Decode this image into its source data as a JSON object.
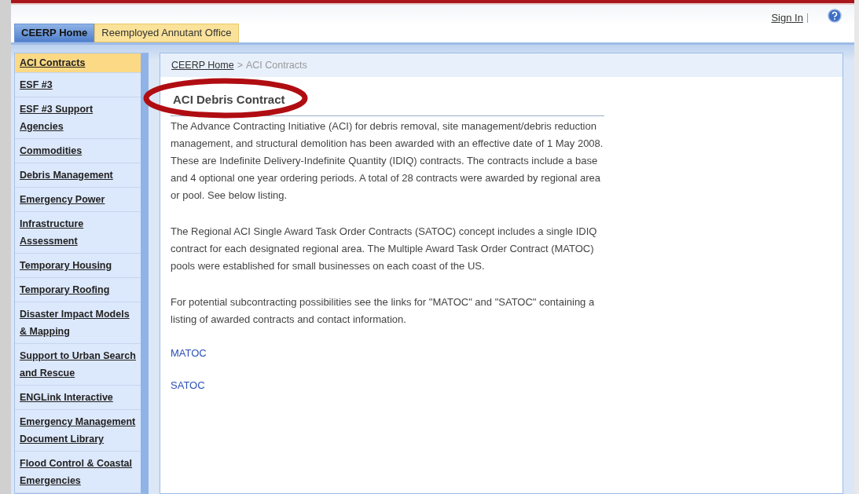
{
  "header": {
    "sign_in": "Sign In",
    "separator": "|"
  },
  "tabs": [
    {
      "label": "CEERP Home",
      "selected": true
    },
    {
      "label": "Reemployed Annutant Office",
      "selected": false
    }
  ],
  "sidebar": {
    "items": [
      {
        "label": "ACI Contracts",
        "selected": true
      },
      {
        "label": "ESF #3",
        "selected": false
      },
      {
        "label": "ESF #3 Support Agencies",
        "selected": false
      },
      {
        "label": "Commodities",
        "selected": false
      },
      {
        "label": "Debris Management",
        "selected": false
      },
      {
        "label": "Emergency Power",
        "selected": false
      },
      {
        "label": "Infrastructure Assessment",
        "selected": false
      },
      {
        "label": "Temporary Housing",
        "selected": false
      },
      {
        "label": "Temporary Roofing",
        "selected": false
      },
      {
        "label": "Disaster Impact Models & Mapping",
        "selected": false
      },
      {
        "label": "Support to Urban Search and Rescue",
        "selected": false
      },
      {
        "label": "ENGLink Interactive",
        "selected": false
      },
      {
        "label": "Emergency Management Document Library",
        "selected": false
      },
      {
        "label": "Flood Control & Coastal Emergencies",
        "selected": false
      }
    ]
  },
  "breadcrumb": {
    "link": "CEERP Home",
    "separator": ">",
    "current": "ACI Contracts"
  },
  "content": {
    "title": "ACI Debris Contract",
    "paragraphs": [
      "The Advance Contracting Initiative (ACI) for debris removal, site management/debris reduction management, and structural demolition has been awarded with an effective date of 1 May 2008.  These are Indefinite Delivery-Indefinite Quantity (IDIQ) contracts.  The contracts include a base and 4 optional one year ordering periods.  A total of 28 contracts were awarded by regional area or pool.  See below listing.",
      "The Regional ACI Single Award Task Order Contracts (SATOC) concept includes a single IDIQ contract for each designated regional area. The Multiple Award Task Order Contract (MATOC) pools were established for small businesses on each coast of the US.",
      "For potential subcontracting possibilities see the links for \"MATOC\" and \"SATOC\" containing a listing of awarded contracts and contact information."
    ],
    "links": [
      "MATOC",
      "SATOC"
    ]
  }
}
